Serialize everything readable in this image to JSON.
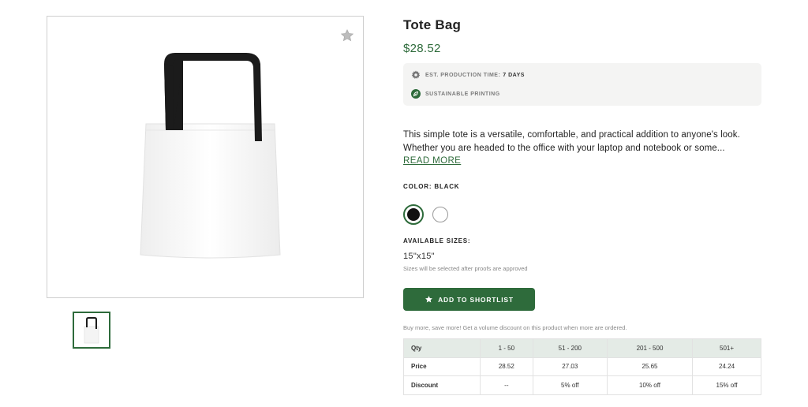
{
  "product": {
    "title": "Tote Bag",
    "price": "$28.52",
    "production_label": "EST. PRODUCTION TIME:",
    "production_value": "7 DAYS",
    "sustainable_label": "SUSTAINABLE PRINTING",
    "description_line1": "This simple tote is a versatile, comfortable, and practical addition to anyone's look.",
    "description_line2": "Whether you are headed to the office with your laptop and notebook or some...",
    "read_more": "READ MORE",
    "color_label": "COLOR: BLACK",
    "colors": [
      {
        "name": "Black",
        "hex": "#111111",
        "selected": true
      },
      {
        "name": "White",
        "hex": "#ffffff",
        "selected": false
      }
    ],
    "sizes_label": "AVAILABLE SIZES:",
    "size_value": "15\"x15\"",
    "size_note": "Sizes will be selected after proofs are approved",
    "shortlist_button": "ADD TO SHORTLIST",
    "volume_note": "Buy more, save more! Get a volume discount on this product when more are ordered."
  },
  "pricing_table": {
    "headers": [
      "Qty",
      "1 - 50",
      "51 - 200",
      "201 - 500",
      "501+"
    ],
    "rows": [
      {
        "label": "Price",
        "values": [
          "28.52",
          "27.03",
          "25.65",
          "24.24"
        ]
      },
      {
        "label": "Discount",
        "values": [
          "--",
          "5% off",
          "10% off",
          "15% off"
        ]
      }
    ]
  },
  "theme": {
    "accent": "#2e6b3b",
    "table_header_bg": "#e4ebe6",
    "info_box_bg": "#f4f4f3"
  },
  "icons": {
    "favorite": "star-icon",
    "production": "gear-icon",
    "sustainable": "leaf-icon",
    "shortlist": "star-icon"
  }
}
